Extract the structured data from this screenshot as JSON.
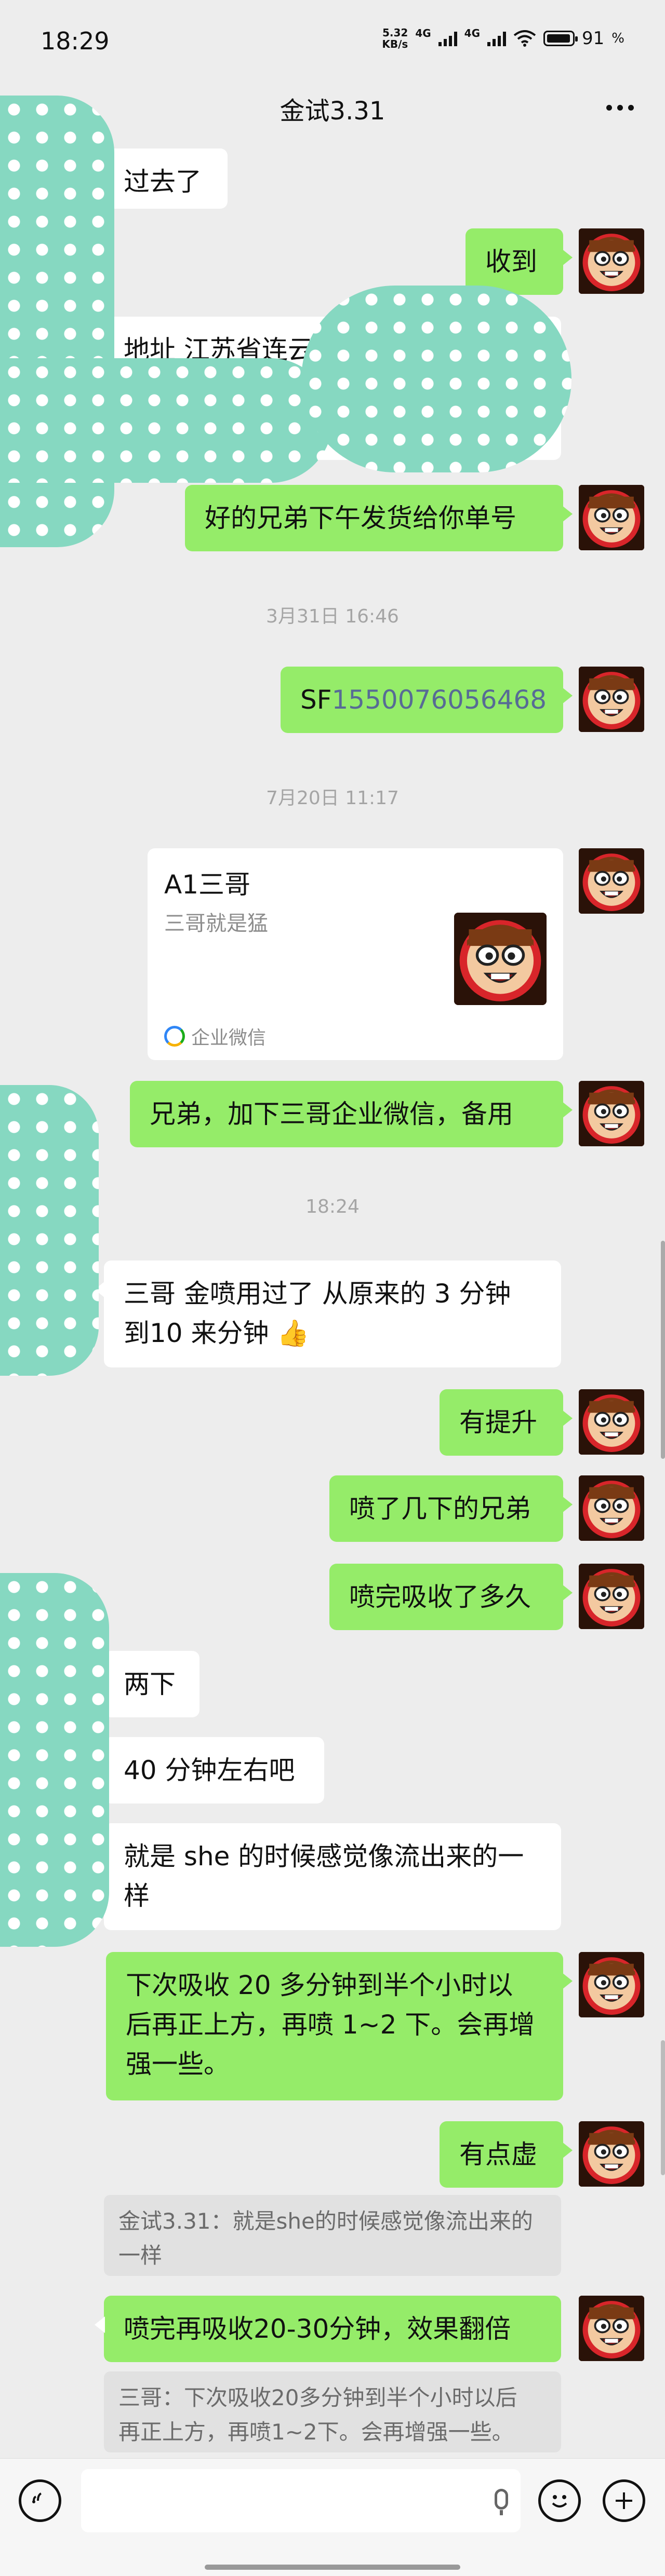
{
  "status": {
    "time": "18:29",
    "net_speed_top": "5.32",
    "net_speed_unit": "KB/s",
    "net_type_1": "4G",
    "net_type_2": "4G",
    "battery": "91"
  },
  "chat": {
    "title": "金试3.31",
    "more_icon": "ellipsis-icon"
  },
  "messages": {
    "m1": "过去了",
    "m2": "收到",
    "m3": "地址 江苏省连云",
    "m4": "好的兄弟下午发货给你单号",
    "ts1": "3月31日 16:46",
    "m5_prefix": "SF",
    "m5_number": "1550076056468",
    "ts2": "7月20日 11:17",
    "card_name": "A1三哥",
    "card_sub": "三哥就是猛",
    "card_source": "企业微信",
    "m6": "兄弟，加下三哥企业微信，备用",
    "ts3": "18:24",
    "m7": "三哥 金喷用过了 从原来的 3 分钟\n到10 来分钟 👍",
    "m8": "有提升",
    "m9": "喷了几下的兄弟",
    "m10": "喷完吸收了多久",
    "m11": "两下",
    "m12": "40 分钟左右吧",
    "m13": "就是 she 的时候感觉像流出来的一\n样",
    "m14": "下次吸收 20 多分钟到半个小时以\n后再正上方，再喷 1~2 下。会再增\n强一些。",
    "m15": "有点虚",
    "q1": "金试3.31：就是she的时候感觉像流出来的\n一样",
    "m16": "喷完再吸收20-30分钟，效果翻倍",
    "q2": "三哥：下次吸收20多分钟到半个小时以后\n再正上方，再喷1~2下。会再增强一些。"
  },
  "input": {
    "voice_icon": "voice-icon",
    "mic_icon": "mic-icon",
    "emoji_icon": "emoji-icon",
    "plus_icon": "plus-icon",
    "placeholder": ""
  },
  "colors": {
    "my_bubble": "#95ec69",
    "other_bubble": "#ffffff",
    "background": "#ededed",
    "link": "#576b95",
    "blob": "#86d8c1"
  }
}
